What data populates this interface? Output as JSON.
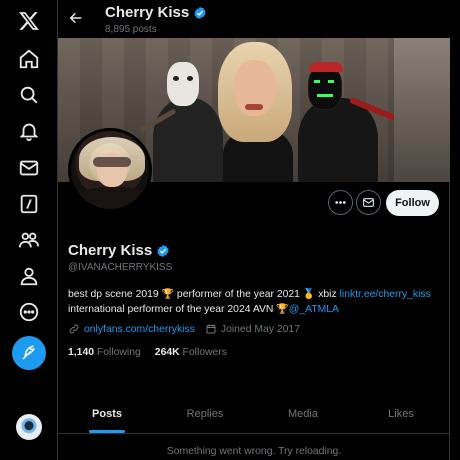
{
  "header": {
    "title": "Cherry Kiss",
    "post_count": "8,895 posts"
  },
  "profile": {
    "name": "Cherry Kiss",
    "handle": "@IVANACHERRYKISS",
    "bio_line1_text": "best dp scene 2019 ",
    "bio_line1_emoji1": "🏆",
    "bio_line1_mid": " performer of the year 2021 ",
    "bio_line1_emoji2": "🥇",
    "bio_line1_xbiz": " xbiz ",
    "bio_link": "linktr.ee/cherry_kiss",
    "bio_line2_text": "international performer of the year 2024 AVN ",
    "bio_line2_emoji": "🏆",
    "bio_mention": "@_ATMLA",
    "website": "onlyfans.com/cherrykiss",
    "joined": "Joined May 2017",
    "following_count": "1,140",
    "following_label": " Following",
    "followers_count": "264K",
    "followers_label": " Followers"
  },
  "actions": {
    "follow_label": "Follow"
  },
  "tabs": [
    {
      "label": "Posts",
      "active": true
    },
    {
      "label": "Replies",
      "active": false
    },
    {
      "label": "Media",
      "active": false
    },
    {
      "label": "Likes",
      "active": false
    }
  ],
  "timeline": {
    "error_text": "Something went wrong. Try reloading."
  },
  "colors": {
    "accent": "#1d9bf0",
    "background": "#000000",
    "text_primary": "#e7e9ea",
    "text_secondary": "#71767b"
  },
  "icons": {
    "rail": [
      "x-logo-icon",
      "home-icon",
      "search-icon",
      "notifications-bell-icon",
      "messages-mail-icon",
      "grok-slash-icon",
      "communities-people-icon",
      "profile-person-icon",
      "more-circle-icon",
      "compose-feather-icon"
    ],
    "header": [
      "back-arrow-icon",
      "verified-badge-icon"
    ],
    "profile_actions": [
      "more-dots-icon",
      "message-mail-icon"
    ],
    "meta": [
      "link-icon",
      "calendar-icon"
    ]
  }
}
